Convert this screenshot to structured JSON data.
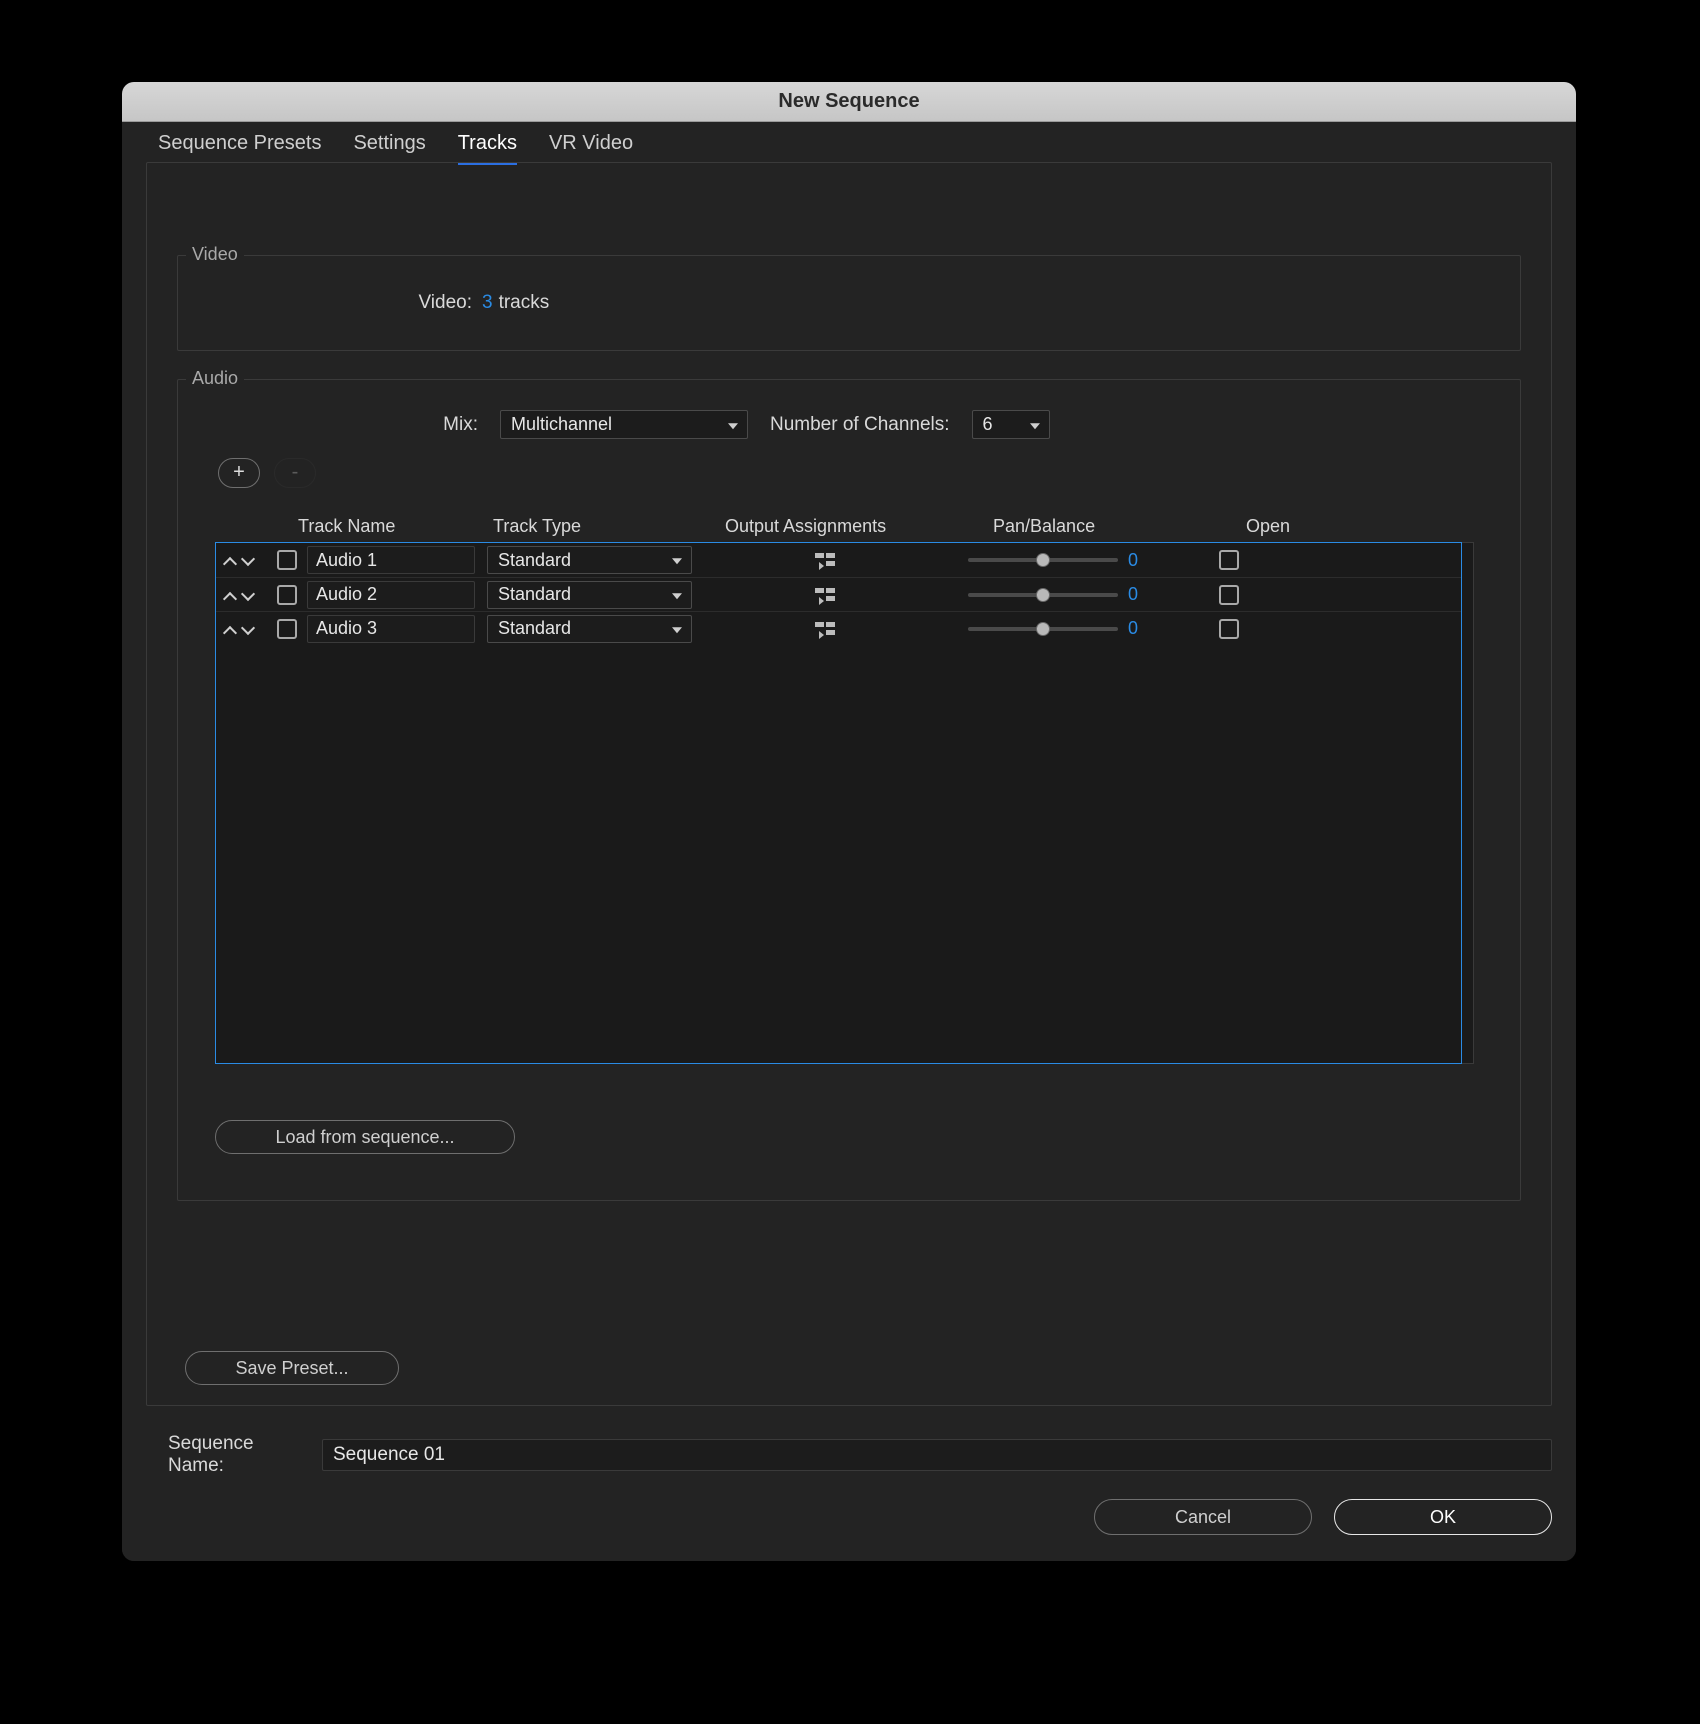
{
  "window": {
    "title": "New Sequence"
  },
  "tabs": {
    "presets": "Sequence Presets",
    "settings": "Settings",
    "tracks": "Tracks",
    "vr": "VR Video",
    "active": "tracks"
  },
  "video_group": {
    "legend": "Video",
    "label": "Video:",
    "count": "3",
    "suffix": "tracks"
  },
  "audio_group": {
    "legend": "Audio",
    "mix_label": "Mix:",
    "mix_value": "Multichannel",
    "chan_label": "Number of Channels:",
    "chan_value": "6",
    "add_label": "+",
    "remove_label": "-",
    "headers": {
      "name": "Track Name",
      "type": "Track Type",
      "out": "Output Assignments",
      "pan": "Pan/Balance",
      "open": "Open"
    },
    "rows": [
      {
        "name": "Audio 1",
        "type": "Standard",
        "pan": "0"
      },
      {
        "name": "Audio 2",
        "type": "Standard",
        "pan": "0"
      },
      {
        "name": "Audio 3",
        "type": "Standard",
        "pan": "0"
      }
    ],
    "load_button": "Load from sequence..."
  },
  "save_preset": "Save Preset...",
  "sequence_name": {
    "label": "Sequence Name:",
    "value": "Sequence 01"
  },
  "footer": {
    "cancel": "Cancel",
    "ok": "OK"
  }
}
